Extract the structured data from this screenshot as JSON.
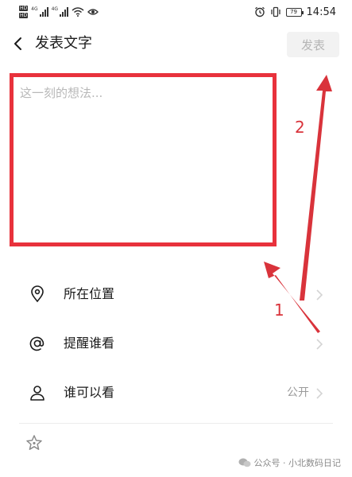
{
  "status_bar": {
    "network_labels": [
      "HD",
      "HD"
    ],
    "signal_labels": [
      "4G",
      "4G"
    ],
    "battery_level": "79",
    "time": "14:54"
  },
  "header": {
    "title": "发表文字",
    "post_label": "发表"
  },
  "compose": {
    "placeholder": "这一刻的想法...",
    "value": ""
  },
  "options": [
    {
      "label": "所在位置",
      "value": "",
      "icon": "location-pin-icon"
    },
    {
      "label": "提醒谁看",
      "value": "",
      "icon": "at-sign-icon"
    },
    {
      "label": "谁可以看",
      "value": "公开",
      "icon": "user-icon"
    }
  ],
  "bottom": {
    "icon": "star-icon"
  },
  "watermark": {
    "text": "公众号 · 小北数码日记"
  },
  "annotations": {
    "labels": [
      "1",
      "2"
    ],
    "color": "#d9333b"
  },
  "colors": {
    "highlight_border": "#e8323c",
    "post_button_bg": "#f2f2f2",
    "post_button_text": "#b5b5b5",
    "placeholder": "#b8b8b8",
    "secondary_text": "#9a9a9a"
  }
}
